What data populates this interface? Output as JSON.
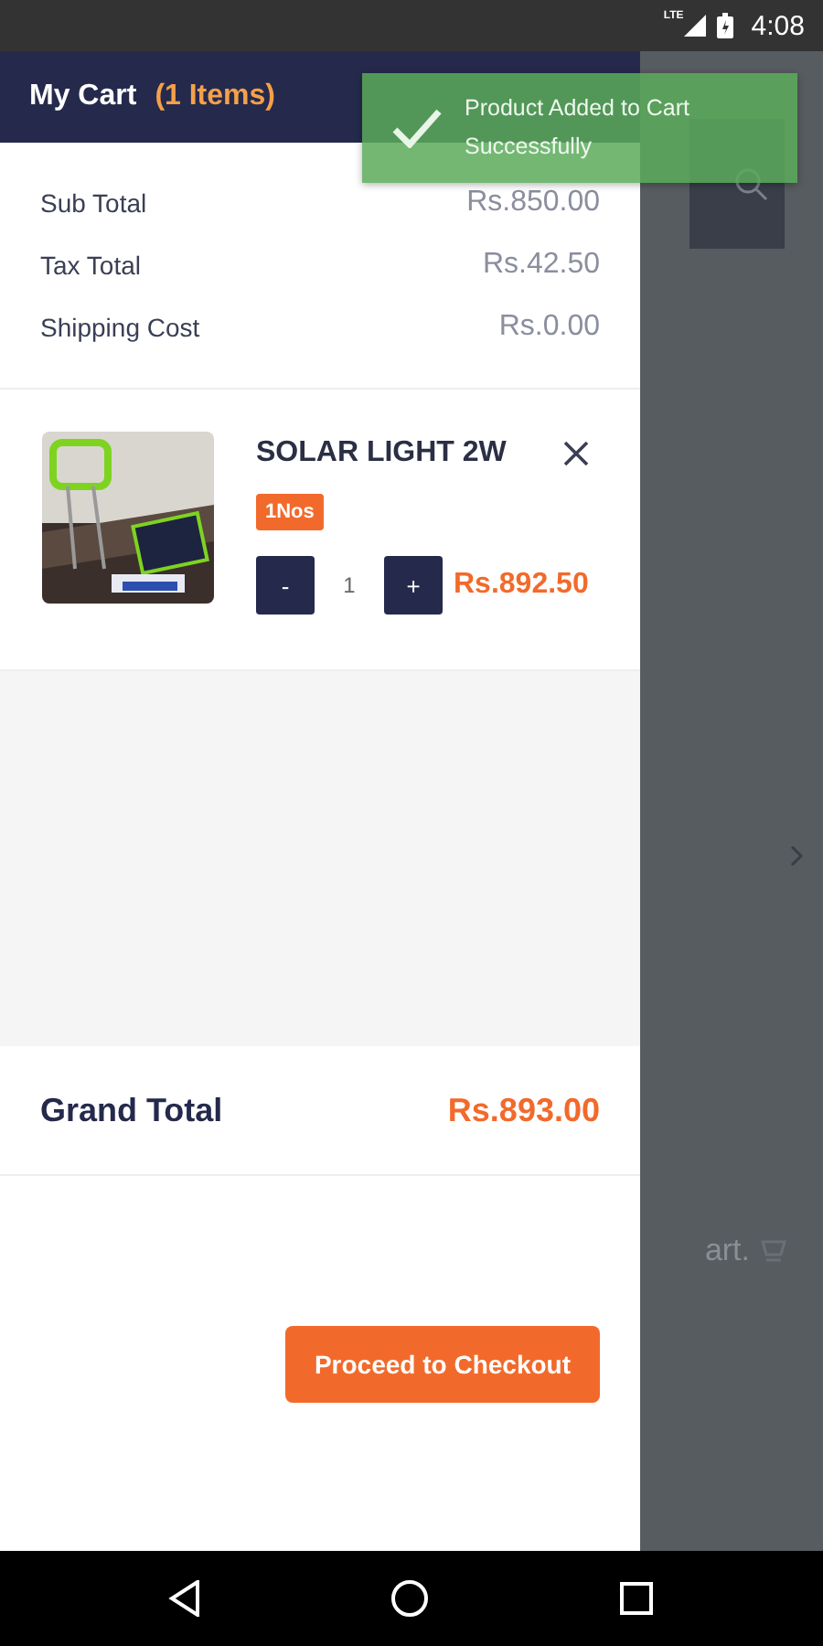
{
  "status_bar": {
    "network": "LTE",
    "time": "4:08"
  },
  "header": {
    "title": "My Cart",
    "count": "(1 Items)"
  },
  "toast": {
    "message": "Product Added to Cart Successfully"
  },
  "summary": [
    {
      "label": "Sub Total",
      "value": "Rs.850.00"
    },
    {
      "label": "Tax Total",
      "value": "Rs.42.50"
    },
    {
      "label": "Shipping Cost",
      "value": "Rs.0.00"
    }
  ],
  "items": [
    {
      "name": "SOLAR LIGHT 2W",
      "unit": "1Nos",
      "quantity": "1",
      "decrement": "-",
      "increment": "+",
      "price": "Rs.892.50"
    }
  ],
  "grand_total": {
    "label": "Grand Total",
    "value": "Rs.893.00"
  },
  "checkout_button": "Proceed to Checkout",
  "background": {
    "text": "art."
  }
}
